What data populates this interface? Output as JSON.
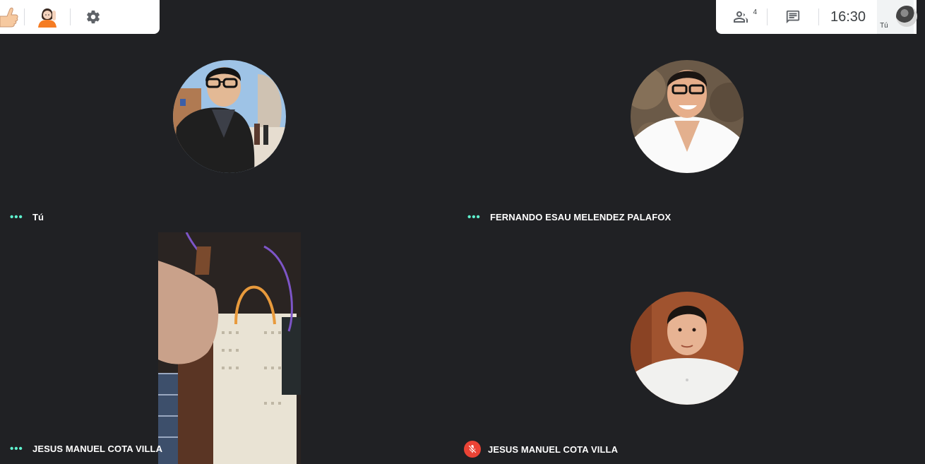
{
  "toolbar_left": {
    "items": [
      {
        "name": "thumbs-up",
        "icon": "thumbs-up-icon"
      },
      {
        "name": "raise-hand",
        "icon": "raise-hand-icon"
      },
      {
        "name": "settings",
        "icon": "gear-icon"
      }
    ]
  },
  "toolbar_right": {
    "people_count": "4",
    "clock": "16:30",
    "self_label": "Tú"
  },
  "tiles": [
    {
      "name": "Tú",
      "status": "speaking-dots"
    },
    {
      "name": "FERNANDO ESAU MELENDEZ PALAFOX",
      "status": "speaking-dots"
    },
    {
      "name": "JESUS MANUEL COTA VILLA",
      "status": "speaking-dots"
    },
    {
      "name": "JESUS MANUEL COTA VILLA",
      "status": "muted"
    }
  ],
  "colors": {
    "background": "#202124",
    "speaking_dots": "#5ff3cf",
    "muted_badge": "#ea4335",
    "toolbar": "#ffffff"
  }
}
